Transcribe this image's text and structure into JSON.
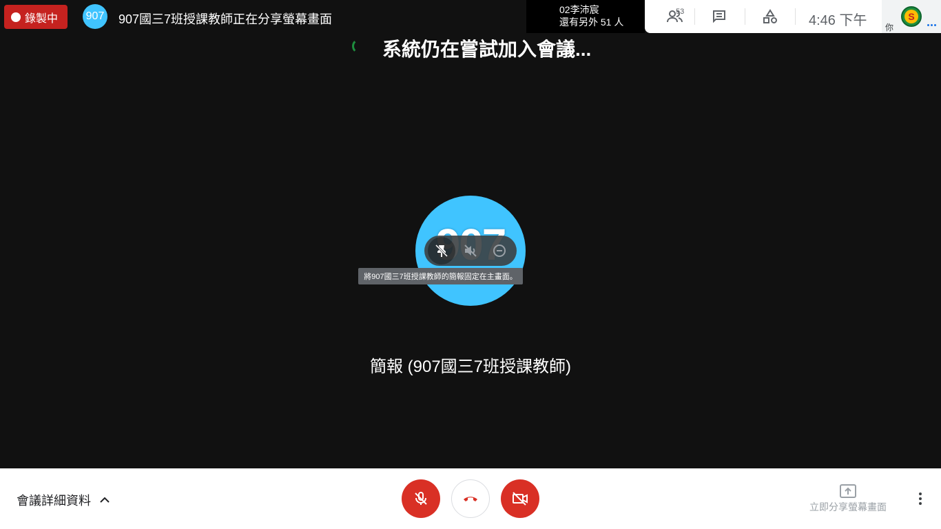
{
  "recording": {
    "label": "錄製中",
    "color": "#c5221f"
  },
  "presenter": {
    "avatar_text": "907",
    "sharing_text": "907國三7班授課教師正在分享螢幕畫面",
    "avatar_color": "#40c4ff"
  },
  "participant_preview": {
    "name": "02李沛宸",
    "others": "還有另外 51 人"
  },
  "top_right": {
    "people_count": "53",
    "people_icon": "people-icon",
    "chat_icon": "chat-icon",
    "activities_icon": "shapes-icon",
    "clock": "4:46  下午",
    "you_label": "你",
    "self_avatar_letter": "S"
  },
  "joining": {
    "text": "系統仍在嘗試加入會議..."
  },
  "tile": {
    "avatar_text": "907",
    "tooltip": "將907國三7班授課教師的簡報固定在主畫面。",
    "name": "簡報 (907國三7班授課教師)",
    "controls": [
      "pin-off-icon",
      "mute-off-icon",
      "remove-icon"
    ]
  },
  "bottom": {
    "meeting_details": "會議詳細資料",
    "mic_icon": "mic-off-icon",
    "hangup_icon": "hangup-icon",
    "camera_icon": "videocam-off-icon",
    "present_now": "立即分享螢幕畫面"
  },
  "colors": {
    "background": "#111111",
    "danger": "#d93025",
    "accent_blue": "#40c4ff"
  }
}
